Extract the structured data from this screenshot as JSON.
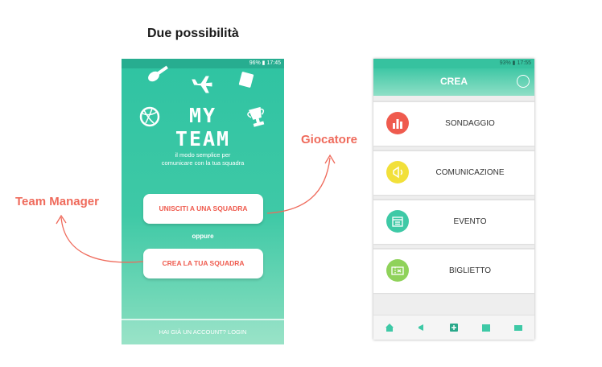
{
  "heading": "Due possibilità",
  "callouts": {
    "left": "Team Manager",
    "right": "Giocatore"
  },
  "left_phone": {
    "status": "96% ▮ 17:45",
    "logo_text": "MY TEAM",
    "tagline_line1": "il modo semplice  per",
    "tagline_line2": "comunicare con la tua squadra",
    "join_button": "UNISCITI A UNA SQUADRA",
    "or_text": "oppure",
    "create_button": "CREA LA TUA SQUADRA",
    "login_link": "HAI GIÀ UN ACCOUNT? LOGIN"
  },
  "right_phone": {
    "status": "93% ▮ 17:55",
    "title": "CREA",
    "items": [
      {
        "label": "SONDAGGIO",
        "icon": "bar-chart-icon",
        "color": "#ef5b4e"
      },
      {
        "label": "COMUNICAZIONE",
        "icon": "megaphone-icon",
        "color": "#f2e03a"
      },
      {
        "label": "EVENTO",
        "icon": "calendar-icon",
        "color": "#3ec9a6"
      },
      {
        "label": "BIGLIETTO",
        "icon": "ticket-icon",
        "color": "#8fd25a"
      }
    ],
    "tabs": [
      "home-icon",
      "megaphone-icon",
      "plus-icon",
      "calendar-icon",
      "ticket-icon"
    ]
  },
  "colors": {
    "accent_red": "#ef5b4e",
    "teal": "#2fc3a2"
  }
}
